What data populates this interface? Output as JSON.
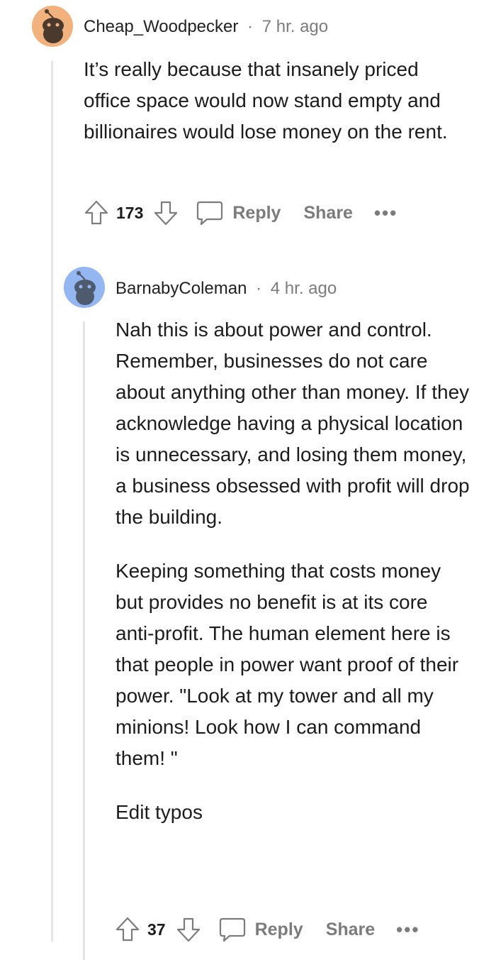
{
  "comments": [
    {
      "username": "Cheap_Woodpecker",
      "separator": "·",
      "time": "7 hr. ago",
      "paragraphs": [
        "It’s really because that insanely priced office space would now stand empty and billionaires would lose money on the rent."
      ],
      "score": "173",
      "reply_label": "Reply",
      "share_label": "Share",
      "more_label": "•••",
      "avatar_color": "#f2b27e"
    },
    {
      "username": "BarnabyColeman",
      "separator": "·",
      "time": "4 hr. ago",
      "paragraphs": [
        "Nah this is about power and control. Remember, businesses do not care about anything other than money. If they acknowledge having a physical location is unnecessary, and losing them money, a business obsessed with profit will drop the building.",
        "Keeping something that costs money but provides no benefit is at its core anti-profit. The human element here is that people in power want proof of their power. \"Look at my tower and all my minions! Look how I can command them! \"",
        "Edit typos"
      ],
      "score": "37",
      "reply_label": "Reply",
      "share_label": "Share",
      "more_label": "•••",
      "avatar_color": "#94b6f1"
    }
  ]
}
